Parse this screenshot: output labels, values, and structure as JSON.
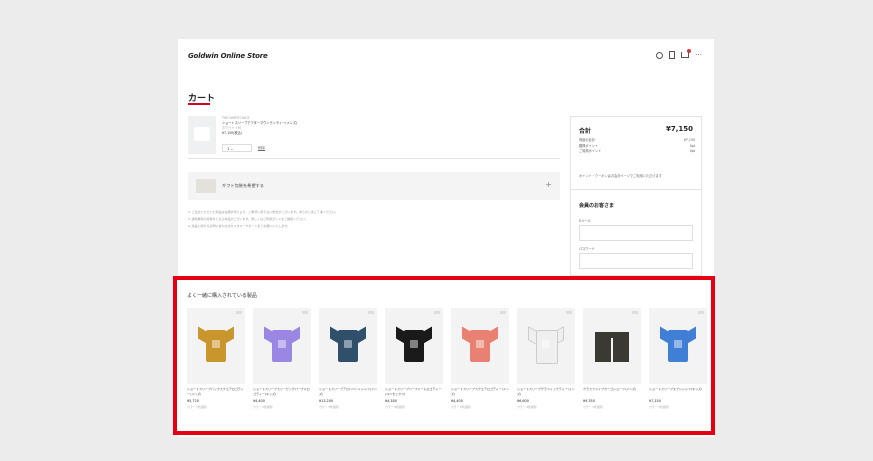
{
  "header": {
    "logo": "Goldwin Online Store"
  },
  "cart": {
    "title": "カート",
    "item": {
      "brand": "THE NORTH FACE",
      "name": "ショートスリーブアフターマウンテンティー(メンズ)",
      "variant": "ホワイト / M",
      "price": "¥7,150(税込)",
      "qty": "1",
      "remove": "削除"
    },
    "gift": {
      "label": "ギフト包装を希望する",
      "plus": "+"
    },
    "notes": [
      "※ ご注文いただいた商品は在庫状況により、ご希望に添えない場合がございます。あらかじめご了承ください。",
      "※ 送料無料の対象外となる商品がございます。詳しくはご利用ガイドをご確認ください。",
      "※ 商品に関するお問い合わせはカスタマーサポートまでお願いいたします。"
    ]
  },
  "summary": {
    "heading": "合計",
    "total": "¥7,150",
    "lines": [
      {
        "label": "商品の合計",
        "value": "¥7,150"
      },
      {
        "label": "獲得ポイント",
        "value": "0pt"
      },
      {
        "label": "ご利用ポイント",
        "value": "0pt"
      }
    ],
    "note": "ポイント・クーポンはお会計ページでご利用いただけます",
    "member_title": "会員のお客さま",
    "email_label": "Eメール",
    "password_label": "パスワード"
  },
  "recommend": {
    "title": "よく一緒に購入されている製品",
    "items": [
      {
        "name": "ショートスリーブバックスクエアロゴティー(メンズ)",
        "price": "¥5,720",
        "colors": "カラー 7色展開",
        "color": "#c9962e"
      },
      {
        "name": "ショートスリーブスリーピングパープルロゴティー(キッズ)",
        "price": "¥4,400",
        "colors": "カラー 5色展開",
        "color": "#9b86e3"
      },
      {
        "name": "ショートスリーブアロハベントシャツ(メンズ)",
        "price": "¥13,200",
        "colors": "カラー 3色展開",
        "color": "#2f4f6a"
      },
      {
        "name": "ショートスリーブハーフドームロゴティー(ユニセックス)",
        "price": "¥4,180",
        "colors": "カラー 8色展開",
        "color": "#1a1a1a"
      },
      {
        "name": "ショートスリーブスクエアロゴティー(メンズ)",
        "price": "¥4,400",
        "colors": "カラー 6色展開",
        "color": "#e98173"
      },
      {
        "name": "ショートスリーブグラフィックティー(メンズ)",
        "price": "¥6,600",
        "colors": "カラー 4色展開",
        "color": "#efefef"
      },
      {
        "name": "クラスファイブカーゴショーツ(メンズ)",
        "price": "¥9,350",
        "colors": "カラー 3色展開",
        "color": "#3a3a32"
      },
      {
        "name": "ショートスリーブヌプシシャツ(キッズ)",
        "price": "¥7,150",
        "colors": "カラー 2色展開",
        "color": "#3f7fd6"
      }
    ]
  },
  "colors": {
    "accent": "#e60012",
    "underline": "#d0021b"
  }
}
